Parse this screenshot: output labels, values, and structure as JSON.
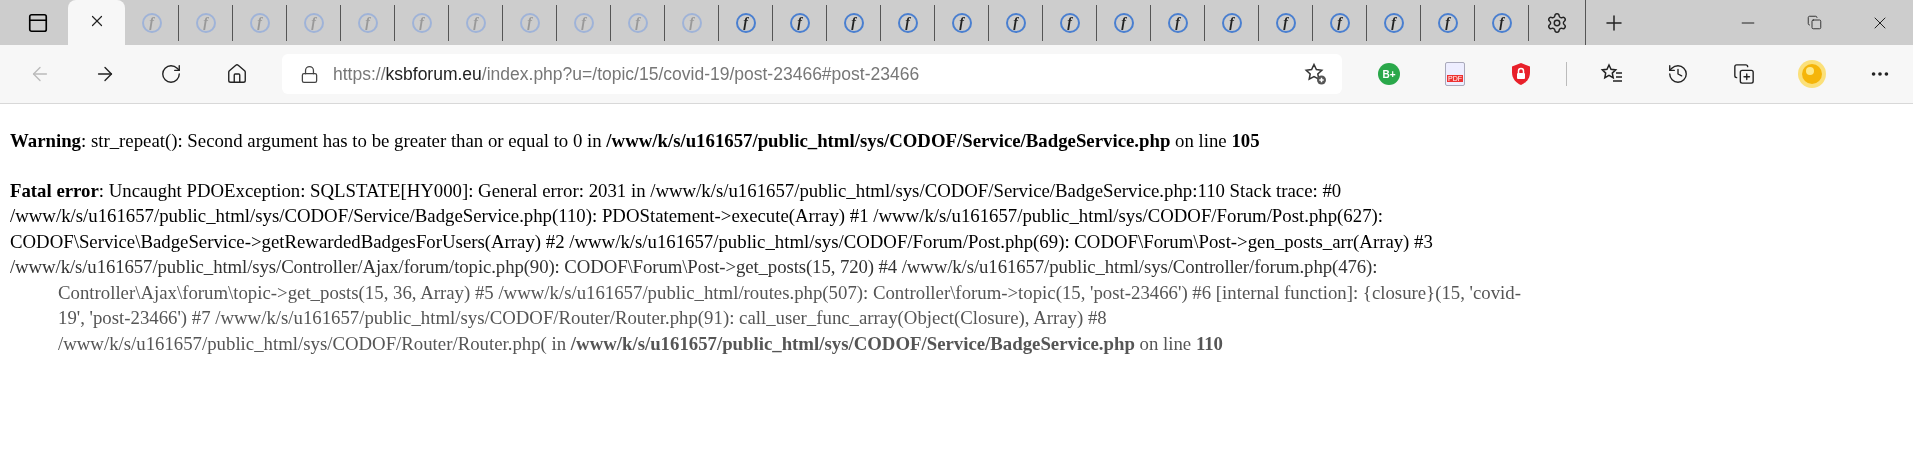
{
  "tabs": [
    {
      "selected": true
    },
    {
      "selected": false,
      "dimmed": true,
      "favicon": "f"
    },
    {
      "selected": false,
      "dimmed": true,
      "favicon": "f"
    },
    {
      "selected": false,
      "dimmed": true,
      "favicon": "f"
    },
    {
      "selected": false,
      "dimmed": true,
      "favicon": "f"
    },
    {
      "selected": false,
      "dimmed": true,
      "favicon": "f"
    },
    {
      "selected": false,
      "dimmed": true,
      "favicon": "f"
    },
    {
      "selected": false,
      "dimmed": true,
      "favicon": "f"
    },
    {
      "selected": false,
      "dimmed": true,
      "favicon": "f"
    },
    {
      "selected": false,
      "dimmed": true,
      "favicon": "f"
    },
    {
      "selected": false,
      "dimmed": true,
      "favicon": "f"
    },
    {
      "selected": false,
      "dimmed": true,
      "favicon": "f"
    },
    {
      "selected": false,
      "dimmed": false,
      "favicon": "f"
    },
    {
      "selected": false,
      "dimmed": false,
      "favicon": "f"
    },
    {
      "selected": false,
      "dimmed": false,
      "favicon": "f"
    },
    {
      "selected": false,
      "dimmed": false,
      "favicon": "f"
    },
    {
      "selected": false,
      "dimmed": false,
      "favicon": "f"
    },
    {
      "selected": false,
      "dimmed": false,
      "favicon": "f"
    },
    {
      "selected": false,
      "dimmed": false,
      "favicon": "f"
    },
    {
      "selected": false,
      "dimmed": false,
      "favicon": "f"
    },
    {
      "selected": false,
      "dimmed": false,
      "favicon": "f"
    },
    {
      "selected": false,
      "dimmed": false,
      "favicon": "f"
    },
    {
      "selected": false,
      "dimmed": false,
      "favicon": "f"
    },
    {
      "selected": false,
      "dimmed": false,
      "favicon": "f"
    },
    {
      "selected": false,
      "dimmed": false,
      "favicon": "f"
    },
    {
      "selected": false,
      "dimmed": false,
      "favicon": "f"
    },
    {
      "selected": false,
      "dimmed": false,
      "favicon": "f"
    }
  ],
  "navigation": {
    "back_disabled": true
  },
  "address_bar": {
    "scheme": "https://",
    "host": "ksbforum.eu",
    "path": "/index.php?u=/topic/15/covid-19/post-23466#post-23466"
  },
  "extensions": [
    {
      "kind": "badge",
      "label": "B+"
    },
    {
      "kind": "pdf",
      "label": "PDF"
    },
    {
      "kind": "shield"
    }
  ],
  "paragraphs": [
    {
      "lines": [
        {
          "kind": "line",
          "text": "**Warning**: str_repeat(): Second argument has to be greater than or equal to 0 in **/www/k/s/u161657/public_html/sys/CODOF/Service/BadgeService.php** on line **105**"
        }
      ]
    },
    {
      "lines": [
        {
          "kind": "line",
          "text": "**Fatal error**: Uncaught PDOException: SQLSTATE[HY000]: General error: 2031 in /www/k/s/u161657/public_html/sys/CODOF/Service/BadgeService.php:110 Stack trace: #0"
        },
        {
          "kind": "line",
          "text": "/www/k/s/u161657/public_html/sys/CODOF/Service/BadgeService.php(110): PDOStatement->execute(Array) #1 /www/k/s/u161657/public_html/sys/CODOF/Forum/Post.php(627):"
        },
        {
          "kind": "line",
          "text": "CODOF\\Service\\BadgeService->getRewardedBadgesForUsers(Array) #2 /www/k/s/u161657/public_html/sys/CODOF/Forum/Post.php(69): CODOF\\Forum\\Post->gen_posts_arr(Array) #3"
        },
        {
          "kind": "glitched",
          "text": "/www/k/s/u161657/public_html/sys/Controller/Ajax/forum/topic.php(90): CODOF\\Forum\\Post->get_posts(15, 720) #4 /www/k/s/u161657/public_html/sys/Controller/forum.php(476):"
        },
        {
          "kind": "faded",
          "text": "Controller\\Ajax\\forum\\topic->get_posts(15, 36, Array) #5 /www/k/s/u161657/public_html/routes.php(507): Controller\\forum->topic(15, 'post-23466') #6 [internal function]: {closure}(15, 'covid-"
        },
        {
          "kind": "faded",
          "text": "19', 'post-23466') #7 /www/k/s/u161657/public_html/sys/CODOF/Router/Router.php(91): call_user_func_array(Object(Closure), Array) #8"
        },
        {
          "kind": "faded",
          "text": "/www/k/s/u161657/public_html/sys/CODOF/Router/Router.php( in **/www/k/s/u161657/public_html/sys/CODOF/Service/BadgeService.php** on line **110**"
        }
      ]
    }
  ]
}
